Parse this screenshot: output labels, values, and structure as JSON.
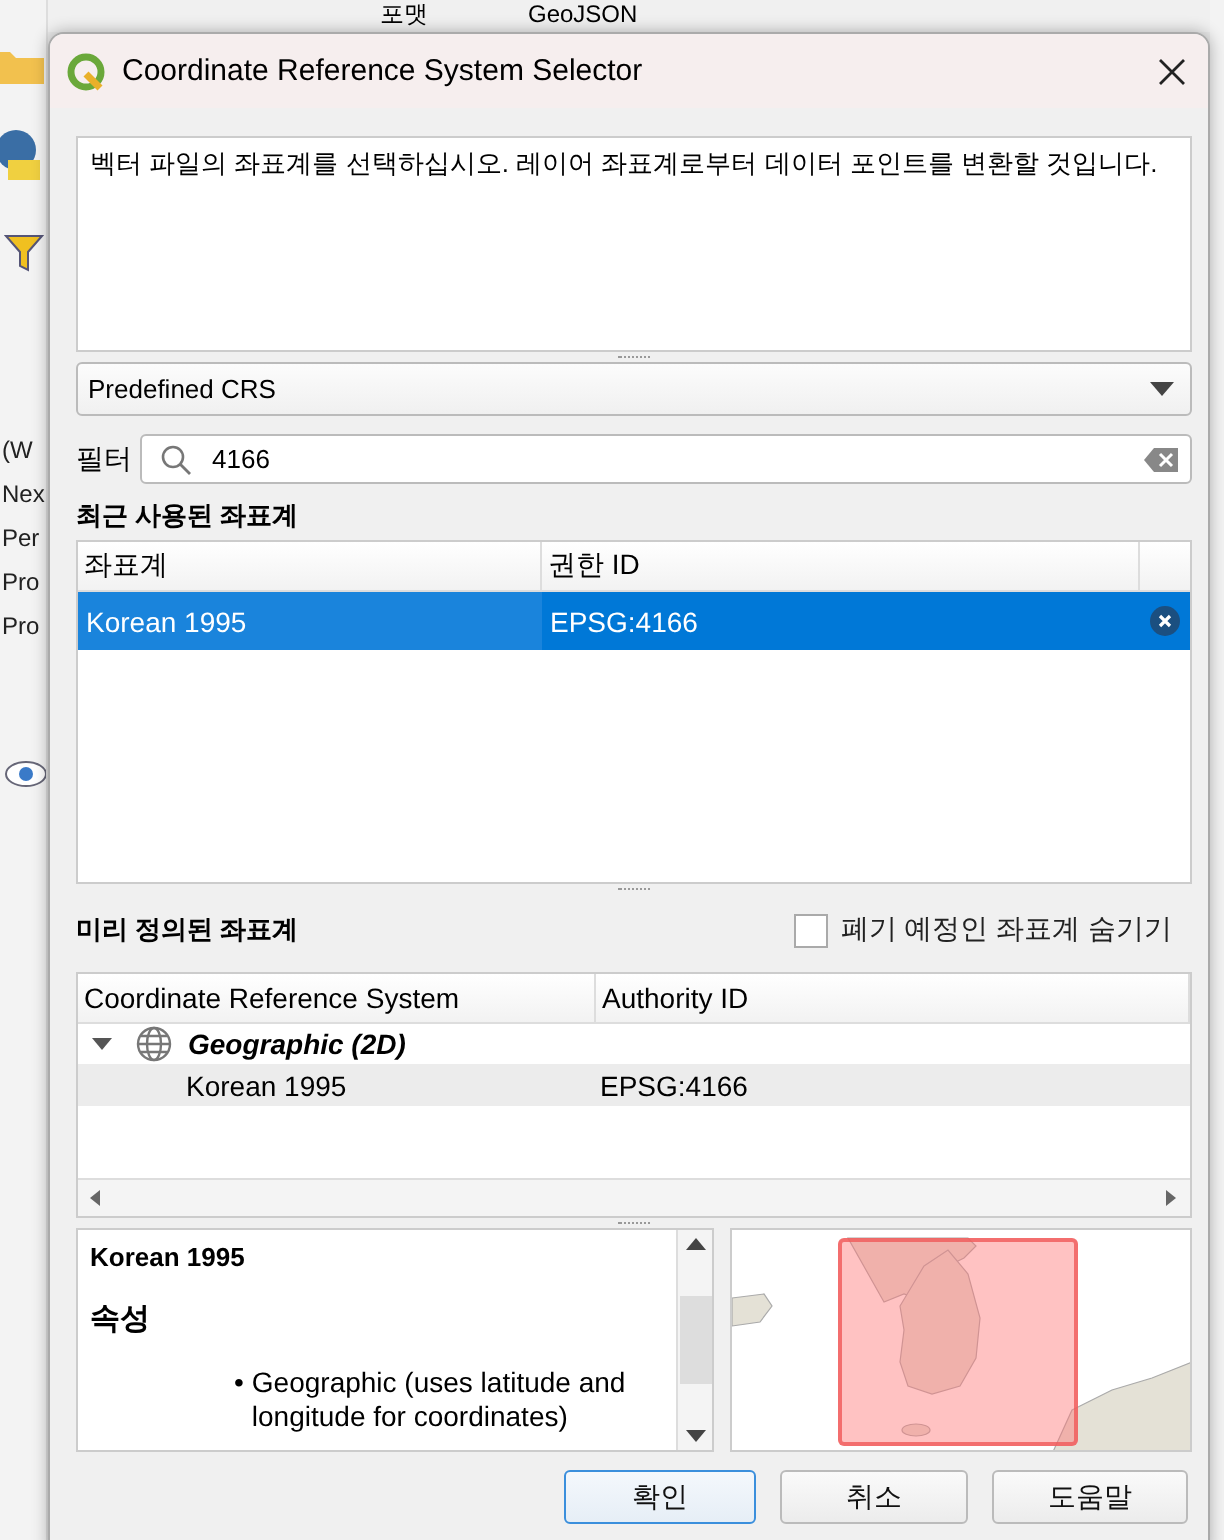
{
  "background": {
    "top_labels": [
      "포맷",
      "GeoJSON"
    ],
    "side_labels": [
      "(W",
      "Nex",
      "Per",
      "Pro",
      "Pro"
    ]
  },
  "dialog": {
    "title": "Coordinate Reference System Selector",
    "message": "벡터 파일의 좌표계를 선택하십시오. 레이어 좌표계로부터 데이터 포인트를 변환할 것입니다.",
    "crs_type": {
      "value": "Predefined CRS"
    },
    "filter": {
      "label": "필터",
      "value": "4166"
    },
    "recent": {
      "heading": "최근 사용된 좌표계",
      "columns": [
        "좌표계",
        "권한 ID"
      ],
      "rows": [
        {
          "cells": [
            "Korean 1995",
            "EPSG:4166"
          ],
          "selected": true
        }
      ]
    },
    "predefined": {
      "heading": "미리 정의된 좌표계",
      "hide_deprecated": {
        "label": "폐기 예정인 좌표계 숨기기",
        "checked": false
      },
      "columns": [
        "Coordinate Reference System",
        "Authority ID"
      ],
      "tree": [
        {
          "label": "Geographic (2D)",
          "expanded": true,
          "children": [
            {
              "label": "Korean 1995",
              "authority": "EPSG:4166",
              "selected": true
            }
          ]
        }
      ]
    },
    "details": {
      "title": "Korean 1995",
      "section": "속성",
      "bullets": [
        {
          "marker": "•",
          "text": "Geographic (uses latitude and longitude for coordinates)"
        }
      ]
    },
    "buttons": [
      {
        "label": "확인",
        "default": true
      },
      {
        "label": "취소",
        "default": false
      },
      {
        "label": "도움말",
        "default": false
      }
    ]
  }
}
